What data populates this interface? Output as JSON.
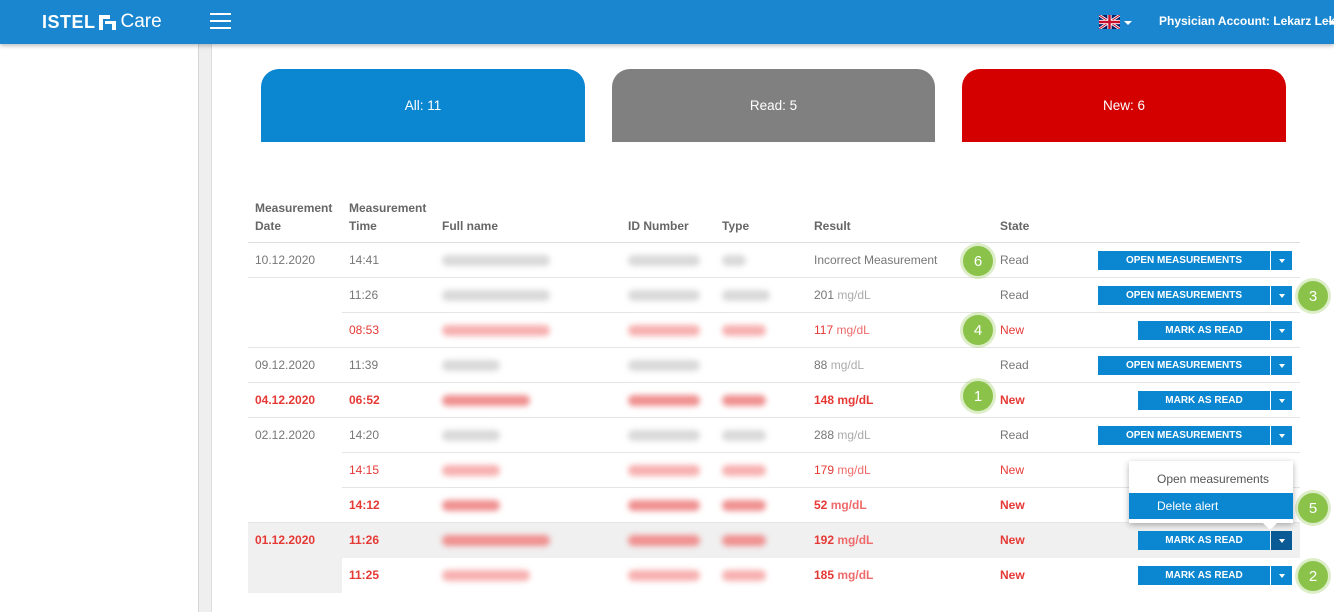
{
  "header": {
    "brand": "ISTEL",
    "brand_sub": "Care",
    "account": "Physician Account: Lekarz Leka"
  },
  "cards": {
    "all": "All: 11",
    "read": "Read: 5",
    "new": "New: 6"
  },
  "table": {
    "headers": {
      "date": "Measurement\nDate",
      "time": "Measurement\nTime",
      "name": "Full name",
      "id": "ID Number",
      "type": "Type",
      "result": "Result",
      "state": "State"
    },
    "rows": [
      {
        "date": "10.12.2020",
        "time": "14:41",
        "result": "Incorrect Measurement",
        "unit": "",
        "state": "Read",
        "button": "OPEN MEASUREMENTS"
      },
      {
        "date": "",
        "time": "11:26",
        "result": "201",
        "unit": "mg/dL",
        "state": "Read",
        "button": "OPEN MEASUREMENTS"
      },
      {
        "date": "",
        "time": "08:53",
        "result": "117",
        "unit": "mg/dL",
        "state": "New",
        "button": "MARK AS READ"
      },
      {
        "date": "09.12.2020",
        "time": "11:39",
        "result": "88",
        "unit": "mg/dL",
        "state": "Read",
        "button": "OPEN MEASUREMENTS"
      },
      {
        "date": "04.12.2020",
        "time": "06:52",
        "result": "148",
        "unit": "mg/dL",
        "state": "New",
        "button": "MARK AS READ"
      },
      {
        "date": "02.12.2020",
        "time": "14:20",
        "result": "288",
        "unit": "mg/dL",
        "state": "Read",
        "button": "OPEN MEASUREMENTS"
      },
      {
        "date": "",
        "time": "14:15",
        "result": "179",
        "unit": "mg/dL",
        "state": "New",
        "button": ""
      },
      {
        "date": "",
        "time": "14:12",
        "result": "52",
        "unit": "mg/dL",
        "state": "New",
        "button": ""
      },
      {
        "date": "01.12.2020",
        "time": "11:26",
        "result": "192",
        "unit": "mg/dL",
        "state": "New",
        "button": "MARK AS READ"
      },
      {
        "date": "",
        "time": "11:25",
        "result": "185",
        "unit": "mg/dL",
        "state": "New",
        "button": "MARK AS READ"
      }
    ]
  },
  "dropdown": {
    "open": "Open measurements",
    "delete": "Delete alert"
  },
  "badges": [
    "6",
    "3",
    "4",
    "1",
    "5",
    "2"
  ],
  "colors": {
    "header": "#1a86d0",
    "button": "#0b86d0",
    "new": "#d40000",
    "read": "#808080",
    "badge": "#8bc34a"
  }
}
